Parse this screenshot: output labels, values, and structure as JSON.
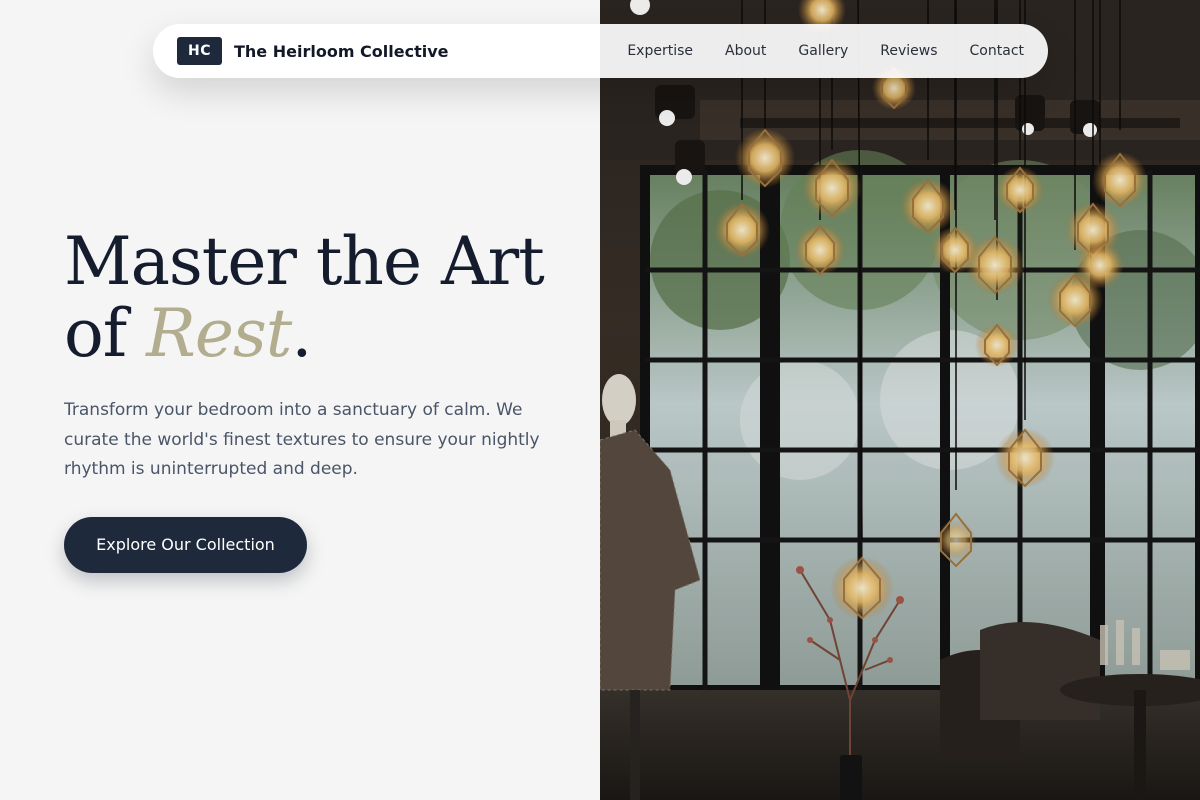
{
  "brand": {
    "badge": "HC",
    "name": "The Heirloom Collective"
  },
  "nav": {
    "links": [
      "Expertise",
      "About",
      "Gallery",
      "Reviews",
      "Contact"
    ]
  },
  "hero": {
    "title_line1": "Master the Art",
    "title_of": "of ",
    "title_accent": "Rest",
    "title_period": ".",
    "description": "Transform your bedroom into a sanctuary of calm. We curate the world's finest textures to ensure your nightly rhythm is uninterrupted and deep.",
    "cta_label": "Explore Our Collection"
  },
  "colors": {
    "primary": "#1e2a3c",
    "accent": "#b3ad8f",
    "background": "#f5f5f5"
  }
}
